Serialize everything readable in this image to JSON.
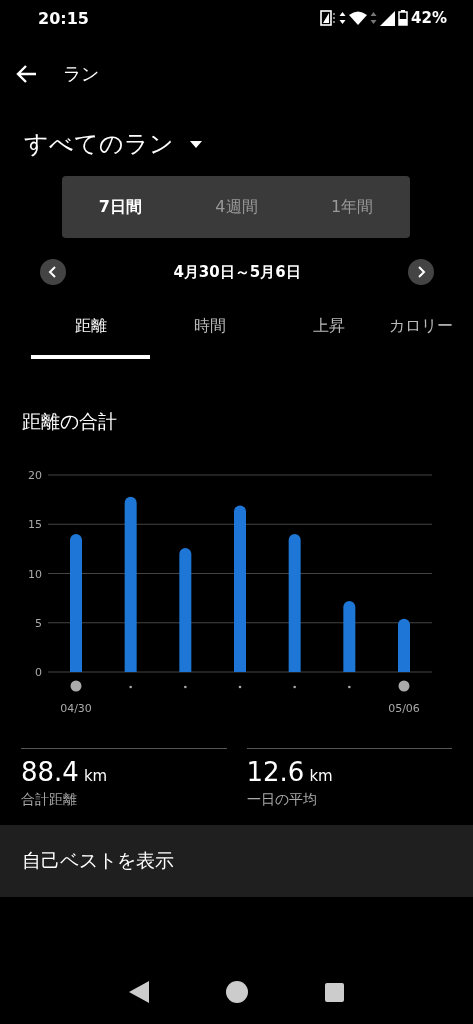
{
  "status_bar": {
    "time": "20:15",
    "battery": "42%"
  },
  "app_bar": {
    "title": "ラン"
  },
  "filter": {
    "label": "すべてのラン"
  },
  "periods": [
    {
      "label": "7日間",
      "selected": true
    },
    {
      "label": "4週間",
      "selected": false
    },
    {
      "label": "1年間",
      "selected": false
    }
  ],
  "date_range": "4月30日～5月6日",
  "tabs": [
    {
      "label": "距離",
      "selected": true
    },
    {
      "label": "時間",
      "selected": false
    },
    {
      "label": "上昇",
      "selected": false
    },
    {
      "label": "カロリー",
      "selected": false
    }
  ],
  "section_title": "距離の合計",
  "chart_data": {
    "type": "bar",
    "categories": [
      "04/30",
      null,
      null,
      null,
      null,
      null,
      "05/06"
    ],
    "ylim": [
      0,
      20
    ],
    "grid": true,
    "yticks": [
      0,
      5,
      10,
      15,
      20
    ],
    "series": [
      {
        "color": "#1e76d6",
        "values": [
          14.0,
          17.8,
          12.6,
          16.9,
          14.0,
          7.2,
          5.4
        ]
      }
    ]
  },
  "stats": [
    {
      "value": "88.4",
      "unit": "km",
      "label": "合計距離"
    },
    {
      "value": "12.6",
      "unit": "km",
      "label": "一日の平均"
    }
  ],
  "personal_best_button": "自己ベストを表示"
}
